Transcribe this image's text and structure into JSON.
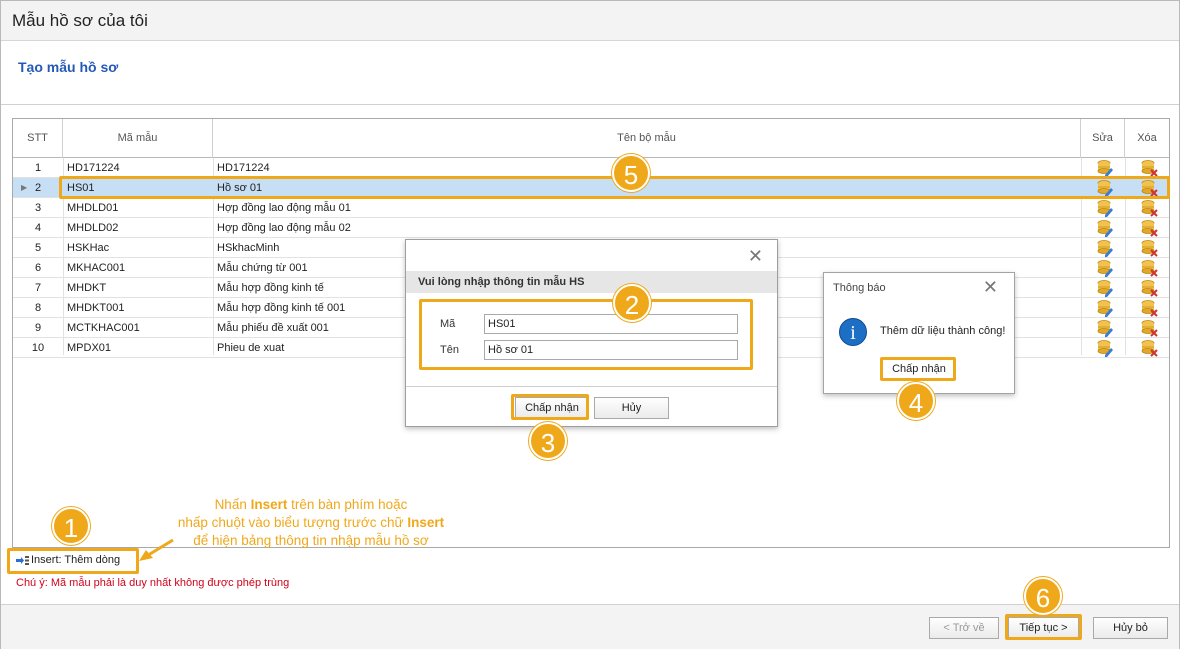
{
  "window": {
    "title": "Mẫu hồ sơ của tôi",
    "subtitle": "Tạo mẫu hồ sơ"
  },
  "grid": {
    "headers": {
      "stt": "STT",
      "ma": "Mã mẫu",
      "ten": "Tên bộ mẫu",
      "sua": "Sửa",
      "xoa": "Xóa"
    },
    "rows": [
      {
        "stt": "1",
        "ma": "HD171224",
        "ten": "HD171224"
      },
      {
        "stt": "2",
        "ma": "HS01",
        "ten": "Hồ sơ 01"
      },
      {
        "stt": "3",
        "ma": "MHDLD01",
        "ten": "Hợp đồng lao động mẫu 01"
      },
      {
        "stt": "4",
        "ma": "MHDLD02",
        "ten": "Hợp đồng lao động mẫu 02"
      },
      {
        "stt": "5",
        "ma": "HSKHac",
        "ten": "HSkhacMinh"
      },
      {
        "stt": "6",
        "ma": "MKHAC001",
        "ten": "Mẫu chứng từ 001"
      },
      {
        "stt": "7",
        "ma": "MHDKT",
        "ten": "Mẫu hợp đồng kinh tế"
      },
      {
        "stt": "8",
        "ma": "MHDKT001",
        "ten": "Mẫu hợp đồng kinh tế 001"
      },
      {
        "stt": "9",
        "ma": "MCTKHAC001",
        "ten": "Mẫu phiếu đề xuất 001"
      },
      {
        "stt": "10",
        "ma": "MPDX01",
        "ten": "Phieu de xuat"
      }
    ],
    "selected_row": "2"
  },
  "dialog": {
    "close": "✕",
    "header": "Vui lòng nhập thông tin mẫu HS",
    "ma_label": "Mã",
    "ma_value": "HS01",
    "ten_label": "Tên",
    "ten_value": "Hồ sơ 01",
    "accept": "Chấp nhận",
    "cancel": "Hủy"
  },
  "info": {
    "title": "Thông báo",
    "close": "✕",
    "icon": "i",
    "message": "Thêm dữ liệu thành công!",
    "accept": "Chấp nhận"
  },
  "insert": {
    "label": "Insert: Thêm dòng"
  },
  "note": "Chú ý: Mã mẫu phải là duy nhất không được phép trùng",
  "callout": {
    "line1_a": "Nhấn ",
    "line1_b": "Insert",
    "line1_c": " trên bàn phím hoặc",
    "line2_a": "nhấp chuột vào biểu tượng trước chữ ",
    "line2_b": "Insert",
    "line3": "để hiện bảng thông tin nhập mẫu hồ sơ"
  },
  "badges": {
    "b1": "1",
    "b2": "2",
    "b3": "3",
    "b4": "4",
    "b5": "5",
    "b6": "6"
  },
  "footer": {
    "back": "< Trở về",
    "next": "Tiếp tục >",
    "cancel": "Hủy bỏ"
  },
  "colors": {
    "accent": "#f0a81b",
    "title_blue": "#2459b8",
    "selected_row": "#c6dff5",
    "note_red": "#d0021b"
  }
}
